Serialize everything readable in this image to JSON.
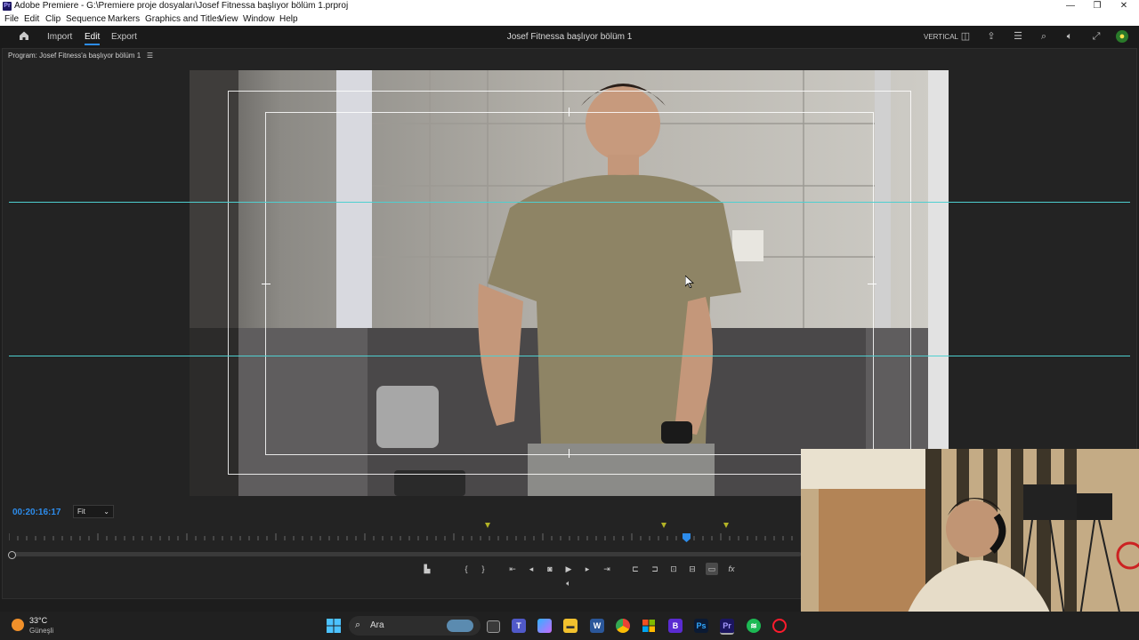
{
  "window": {
    "title": "Adobe Premiere - G:\\Premiere proje dosyaları\\Josef Fitnessa başlıyor bölüm 1.prproj",
    "app_icon": "Pr"
  },
  "menu": [
    "File",
    "Edit",
    "Clip",
    "Sequence",
    "Markers",
    "Graphics and Titles",
    "View",
    "Window",
    "Help"
  ],
  "header": {
    "nav": [
      "Import",
      "Edit",
      "Export"
    ],
    "active_nav": "Edit",
    "project_title": "Josef Fitnessa başlıyor bölüm 1",
    "layout_label": "VERTICAL"
  },
  "program_monitor": {
    "label": "Program: Josef Fitness'a başlıyor bölüm 1",
    "timecode": "00:20:16:17",
    "zoom": "Fit"
  },
  "colors": {
    "accent": "#2d8ceb",
    "guide": "#4ecfd0",
    "marker": "#b3b326"
  },
  "weather": {
    "temp": "33°C",
    "condition": "Güneşli"
  },
  "taskbar": {
    "search_label": "Ara",
    "apps": [
      "windows-start",
      "search",
      "task-view",
      "teams",
      "copilot",
      "file-explorer",
      "word",
      "chrome",
      "microsoft-store",
      "edge-dev",
      "photoshop",
      "premiere-pro",
      "spotify",
      "opera"
    ]
  },
  "icons": {
    "home": "home-icon",
    "controls": [
      "add-marker",
      "mark-in",
      "mark-out",
      "go-to-in",
      "step-back",
      "export-frame",
      "play",
      "step-forward",
      "go-to-out",
      "insert",
      "overwrite",
      "lift",
      "extract",
      "safe-margins",
      "fx"
    ]
  }
}
